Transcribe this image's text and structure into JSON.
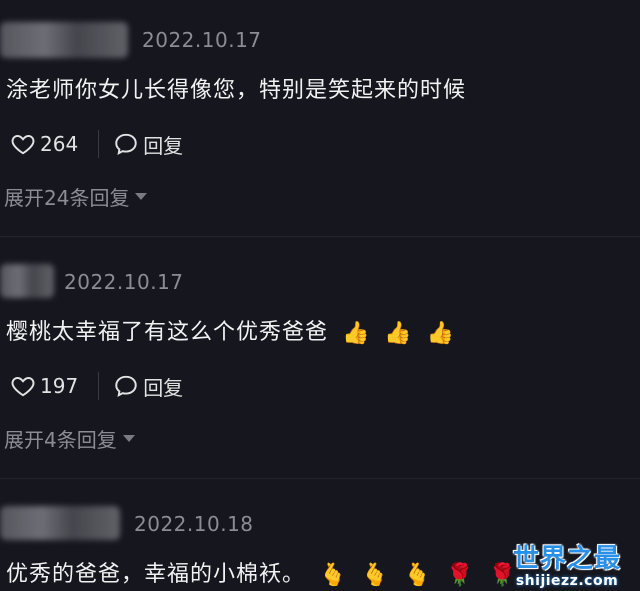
{
  "comments": [
    {
      "timestamp": "2022.10.17",
      "text": "涂老师你女儿长得像您，特别是笑起来的时候",
      "likes": "264",
      "reply_label": "回复",
      "expand_label": "展开24条回复",
      "emojis": []
    },
    {
      "timestamp": "2022.10.17",
      "text": "樱桃太幸福了有这么个优秀爸爸",
      "likes": "197",
      "reply_label": "回复",
      "expand_label": "展开4条回复",
      "emojis": [
        "👍",
        "👍",
        "👍"
      ]
    },
    {
      "timestamp": "2022.10.18",
      "text": "优秀的爸爸，幸福的小棉袄。",
      "emojis": [
        "🫰",
        "🫰",
        "🫰",
        "🌹",
        "🌹"
      ]
    }
  ],
  "watermark": {
    "main": "世界之最",
    "sub": "shijiezz.com"
  },
  "colors": {
    "background": "#16161f",
    "text": "#f2f2f2",
    "muted": "#8c8c96",
    "watermark": "#2a8fe6"
  }
}
